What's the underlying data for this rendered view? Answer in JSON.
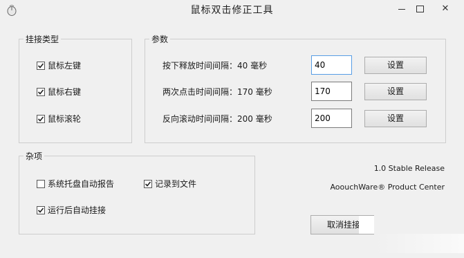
{
  "window": {
    "title": "鼠标双击修正工具",
    "app_icon": "app-icon"
  },
  "groups": {
    "hook_type": {
      "title": "挂接类型",
      "items": [
        {
          "label": "鼠标左键",
          "checked": true
        },
        {
          "label": "鼠标右键",
          "checked": true
        },
        {
          "label": "鼠标滚轮",
          "checked": true
        }
      ]
    },
    "params": {
      "title": "参数",
      "rows": [
        {
          "label": "按下释放时间间隔：40 毫秒",
          "value": "40",
          "button": "设置"
        },
        {
          "label": "两次点击时间间隔：170 毫秒",
          "value": "170",
          "button": "设置"
        },
        {
          "label": "反向滚动时间间隔：200 毫秒",
          "value": "200",
          "button": "设置"
        }
      ]
    },
    "misc": {
      "title": "杂项",
      "items": [
        {
          "label": "系统托盘自动报告",
          "checked": false
        },
        {
          "label": "记录到文件",
          "checked": true
        },
        {
          "label": "运行后自动挂接",
          "checked": true
        }
      ]
    }
  },
  "info": {
    "version": "1.0 Stable Release",
    "company": "AoouchWare® Product Center"
  },
  "footer": {
    "unhook_button": "取消挂接"
  }
}
